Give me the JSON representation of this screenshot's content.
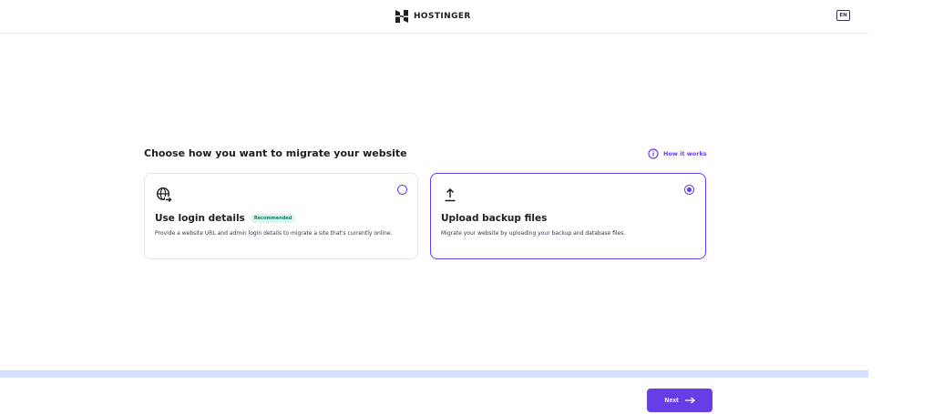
{
  "header": {
    "brand": "HOSTINGER",
    "language": "EN"
  },
  "migration": {
    "title": "Choose how you want to migrate your website",
    "how_it_works": "How it works",
    "options": [
      {
        "title": "Use login details",
        "badge": "Recommended",
        "description": "Provide a website URL and admin login details to migrate a site that's currently online.",
        "icon": "globe-arrow-icon",
        "selected": false
      },
      {
        "title": "Upload backup files",
        "description": "Migrate your website by uploading your backup and database files.",
        "icon": "upload-icon",
        "selected": true
      }
    ]
  },
  "footer": {
    "next_label": "Next"
  },
  "colors": {
    "accent": "#673de6",
    "badge_bg": "#def4f0",
    "badge_text": "#008361",
    "progress_bar": "#d5dfff"
  }
}
